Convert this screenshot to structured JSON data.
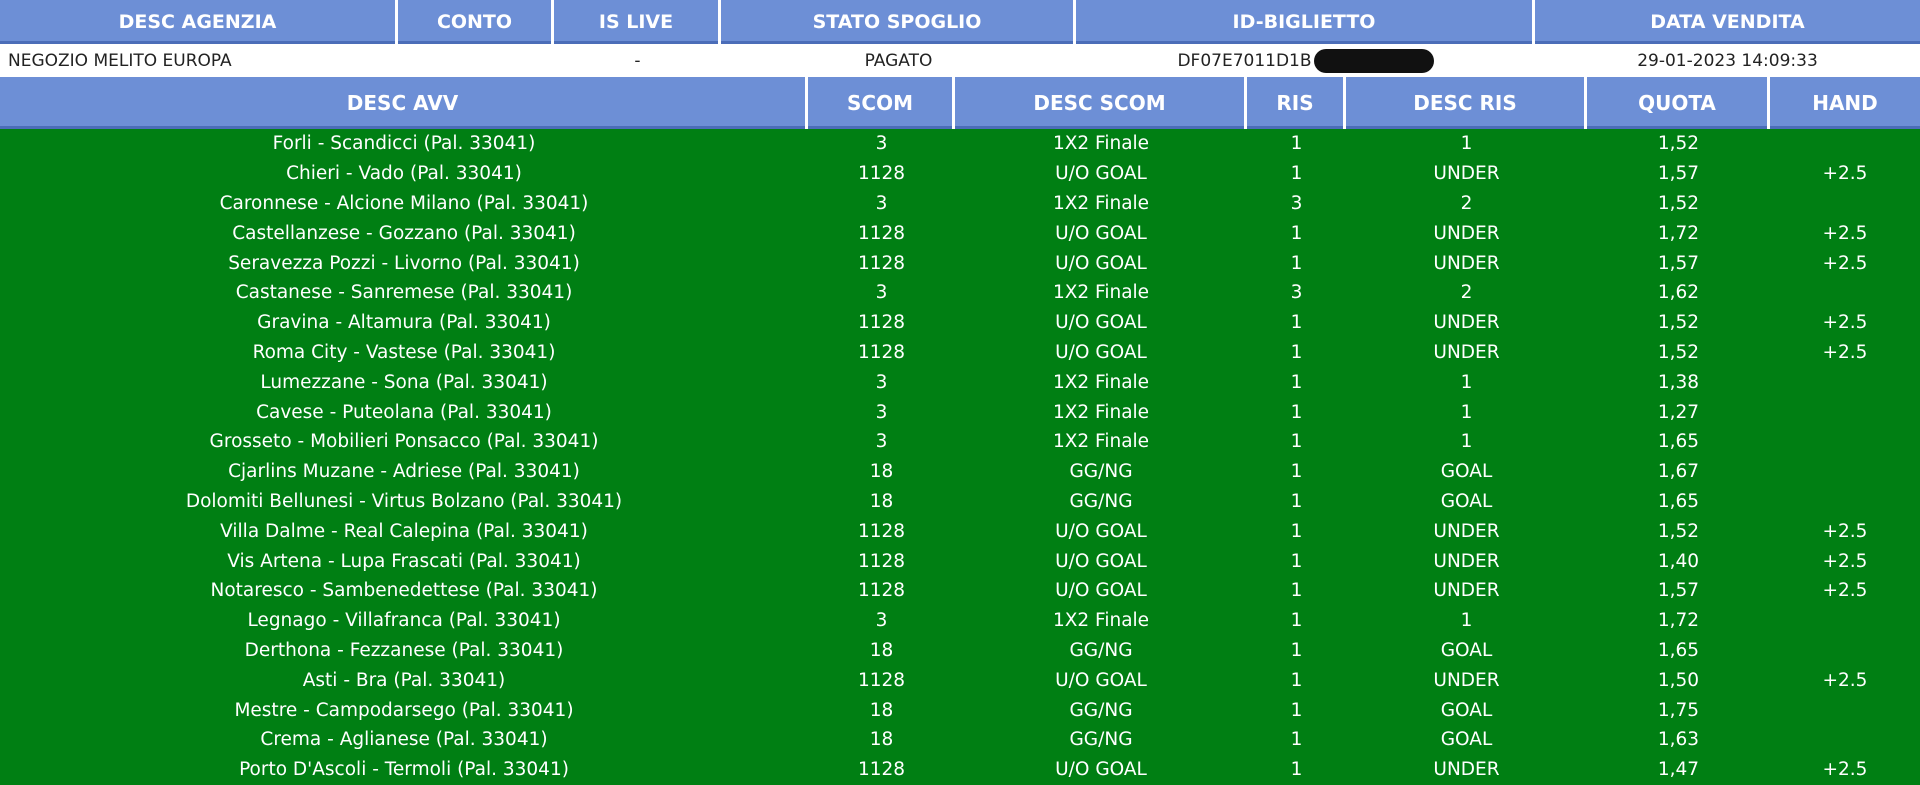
{
  "top_headers": [
    "DESC AGENZIA",
    "CONTO",
    "IS LIVE",
    "STATO SPOGLIO",
    "ID-BIGLIETTO",
    "DATA VENDITA"
  ],
  "info": {
    "desc_agenzia": "NEGOZIO MELITO EUROPA",
    "conto": "",
    "is_live": "-",
    "stato_spoglio": "PAGATO",
    "id_biglietto": "DF07E7011D1B",
    "data_vendita": "29-01-2023 14:09:33"
  },
  "table_headers": [
    "DESC AVV",
    "SCOM",
    "DESC SCOM",
    "RIS",
    "DESC RIS",
    "QUOTA",
    "HAND"
  ],
  "rows": [
    [
      "Forli - Scandicci (Pal. 33041)",
      "3",
      "1X2 Finale",
      "1",
      "1",
      "1,52",
      ""
    ],
    [
      "Chieri - Vado (Pal. 33041)",
      "1128",
      "U/O GOAL",
      "1",
      "UNDER",
      "1,57",
      "+2.5"
    ],
    [
      "Caronnese - Alcione Milano (Pal. 33041)",
      "3",
      "1X2 Finale",
      "3",
      "2",
      "1,52",
      ""
    ],
    [
      "Castellanzese - Gozzano (Pal. 33041)",
      "1128",
      "U/O GOAL",
      "1",
      "UNDER",
      "1,72",
      "+2.5"
    ],
    [
      "Seravezza Pozzi - Livorno (Pal. 33041)",
      "1128",
      "U/O GOAL",
      "1",
      "UNDER",
      "1,57",
      "+2.5"
    ],
    [
      "Castanese - Sanremese (Pal. 33041)",
      "3",
      "1X2 Finale",
      "3",
      "2",
      "1,62",
      ""
    ],
    [
      "Gravina - Altamura (Pal. 33041)",
      "1128",
      "U/O GOAL",
      "1",
      "UNDER",
      "1,52",
      "+2.5"
    ],
    [
      "Roma City - Vastese (Pal. 33041)",
      "1128",
      "U/O GOAL",
      "1",
      "UNDER",
      "1,52",
      "+2.5"
    ],
    [
      "Lumezzane - Sona (Pal. 33041)",
      "3",
      "1X2 Finale",
      "1",
      "1",
      "1,38",
      ""
    ],
    [
      "Cavese - Puteolana (Pal. 33041)",
      "3",
      "1X2 Finale",
      "1",
      "1",
      "1,27",
      ""
    ],
    [
      "Grosseto - Mobilieri Ponsacco (Pal. 33041)",
      "3",
      "1X2 Finale",
      "1",
      "1",
      "1,65",
      ""
    ],
    [
      "Cjarlins Muzane - Adriese (Pal. 33041)",
      "18",
      "GG/NG",
      "1",
      "GOAL",
      "1,67",
      ""
    ],
    [
      "Dolomiti Bellunesi - Virtus Bolzano (Pal. 33041)",
      "18",
      "GG/NG",
      "1",
      "GOAL",
      "1,65",
      ""
    ],
    [
      "Villa Dalme - Real Calepina (Pal. 33041)",
      "1128",
      "U/O GOAL",
      "1",
      "UNDER",
      "1,52",
      "+2.5"
    ],
    [
      "Vis Artena - Lupa Frascati (Pal. 33041)",
      "1128",
      "U/O GOAL",
      "1",
      "UNDER",
      "1,40",
      "+2.5"
    ],
    [
      "Notaresco - Sambenedettese (Pal. 33041)",
      "1128",
      "U/O GOAL",
      "1",
      "UNDER",
      "1,57",
      "+2.5"
    ],
    [
      "Legnago - Villafranca (Pal. 33041)",
      "3",
      "1X2 Finale",
      "1",
      "1",
      "1,72",
      ""
    ],
    [
      "Derthona - Fezzanese (Pal. 33041)",
      "18",
      "GG/NG",
      "1",
      "GOAL",
      "1,65",
      ""
    ],
    [
      "Asti - Bra (Pal. 33041)",
      "1128",
      "U/O GOAL",
      "1",
      "UNDER",
      "1,50",
      "+2.5"
    ],
    [
      "Mestre - Campodarsego (Pal. 33041)",
      "18",
      "GG/NG",
      "1",
      "GOAL",
      "1,75",
      ""
    ],
    [
      "Crema - Aglianese (Pal. 33041)",
      "18",
      "GG/NG",
      "1",
      "GOAL",
      "1,63",
      ""
    ],
    [
      "Porto D'Ascoli - Termoli (Pal. 33041)",
      "1128",
      "U/O GOAL",
      "1",
      "UNDER",
      "1,47",
      "+2.5"
    ]
  ],
  "colors": {
    "header_bg": "#6d8fd6",
    "table_bg": "#007f13",
    "text_on_green": "#ffffff"
  }
}
